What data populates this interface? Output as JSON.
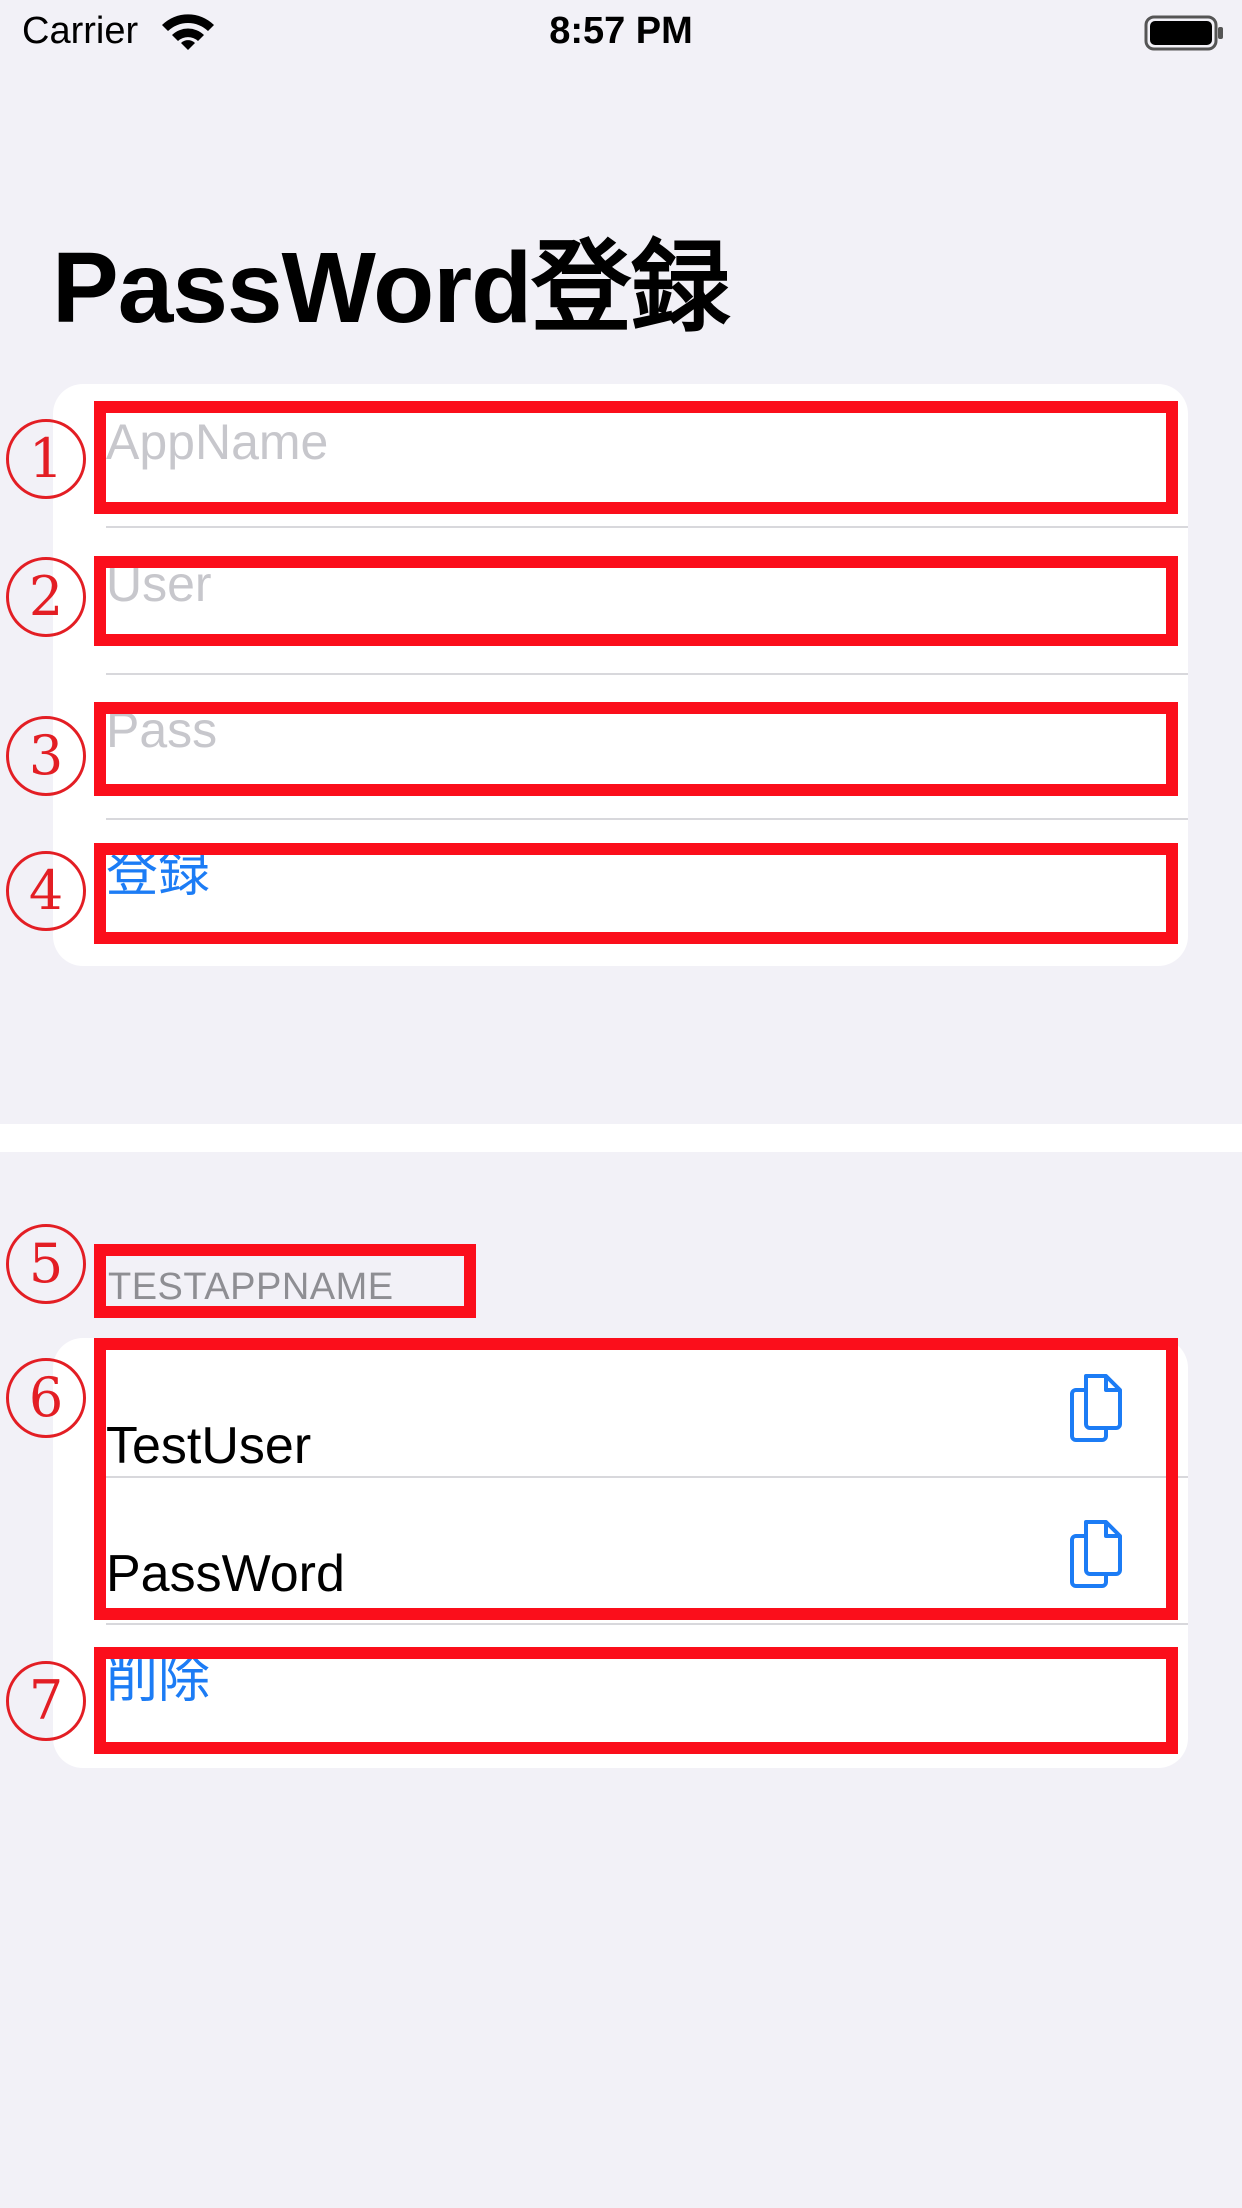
{
  "status_bar": {
    "carrier": "Carrier",
    "time": "8:57 PM"
  },
  "title": "PassWord登録",
  "form": {
    "app_name_placeholder": "AppName",
    "user_placeholder": "User",
    "pass_placeholder": "Pass",
    "register_label": "登録"
  },
  "entry": {
    "section_header": "TESTAPPNAME",
    "user_value": "TestUser",
    "password_value": "PassWord",
    "delete_label": "削除"
  },
  "annotations": [
    "1",
    "2",
    "3",
    "4",
    "5",
    "6",
    "7"
  ],
  "colors": {
    "accent": "#1c7cf5",
    "highlight": "#fb0e1b",
    "background": "#f2f1f7"
  }
}
